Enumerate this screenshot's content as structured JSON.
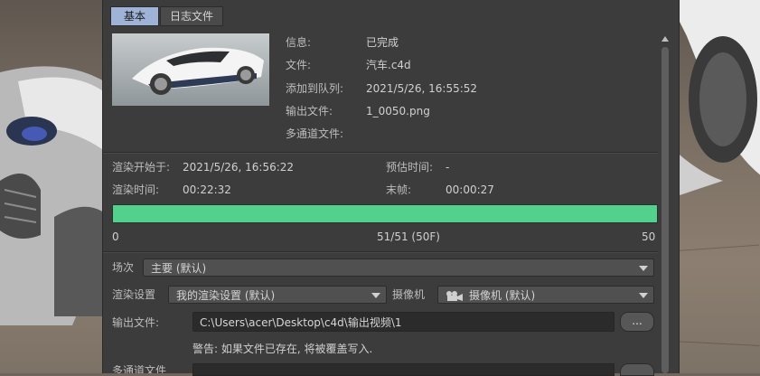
{
  "tabs": [
    {
      "label": "基本",
      "active": true
    },
    {
      "label": "日志文件",
      "active": false
    }
  ],
  "info": {
    "status_label": "信息:",
    "status_value": "已完成",
    "file_label": "文件:",
    "file_value": "汽车.c4d",
    "queued_label": "添加到队列:",
    "queued_value": "2021/5/26, 16:55:52",
    "output_label": "输出文件:",
    "output_value": "1_0050.png",
    "multipass_label": "多通道文件:"
  },
  "timing": {
    "start_label": "渲染开始于:",
    "start_value": "2021/5/26, 16:56:22",
    "estimate_label": "预估时间:",
    "estimate_value": "-",
    "elapsed_label": "渲染时间:",
    "elapsed_value": "00:22:32",
    "last_frame_label": "末帧:",
    "last_frame_value": "00:00:27"
  },
  "progress": {
    "fraction": 1.0,
    "min_label": "0",
    "center_label": "51/51 (50F)",
    "max_label": "50",
    "color": "#52d18d"
  },
  "settings": {
    "take_label": "场次",
    "take_value": "主要 (默认)",
    "render_settings_label": "渲染设置",
    "render_settings_value": "我的渲染设置 (默认)",
    "camera_label": "摄像机",
    "camera_value": "摄像机 (默认)",
    "output_file_label": "输出文件:",
    "output_path": "C:\\Users\\acer\\Desktop\\c4d\\输出视频\\1",
    "browse_label": "...",
    "warning": "警告: 如果文件已存在, 将被覆盖写入.",
    "multipass_label": "多通道文件"
  },
  "colors": {
    "panel_bg": "#3c3c3c",
    "active_tab": "#9fb3d6",
    "progress": "#52d18d"
  }
}
